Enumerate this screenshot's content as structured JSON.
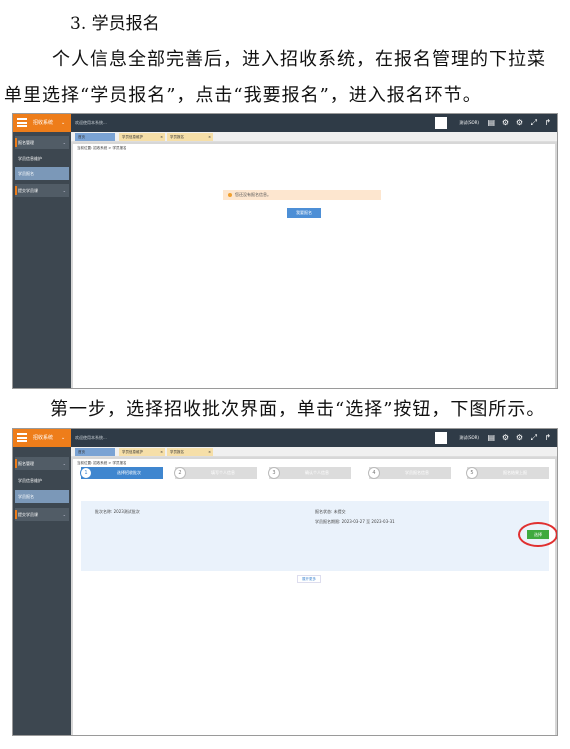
{
  "doc": {
    "heading": "3. 学员报名",
    "line1": "个人信息全部完善后，进入招收系统，在报名管理的下拉菜",
    "line2": "单里选择“学员报名”，点击“我要报名”，进入报名环节。",
    "step1": "第一步，选择招收批次界面，单击“选择”按钮，下图所示。"
  },
  "app": {
    "system_name": "招收系统",
    "notice": "欢迎使用本系统...",
    "user_name": "测试(SOR)",
    "sidebar_items": [
      "报名管理",
      "学员信息维护",
      "学员报名",
      "提交学员课"
    ],
    "tabs": [
      "首页",
      "学员信息维护",
      "学员报名"
    ],
    "breadcrumb": "当前位置: 招收系统 > 学员报名"
  },
  "screen1": {
    "alert_text": "您还没有报名信息。",
    "signup_button": "我要报名"
  },
  "screen2": {
    "steps": [
      {
        "num": "1",
        "label": "选择招收批次"
      },
      {
        "num": "2",
        "label": "填写个人信息"
      },
      {
        "num": "3",
        "label": "确认个人信息"
      },
      {
        "num": "4",
        "label": "学员报名信息"
      },
      {
        "num": "5",
        "label": "报名结果上报"
      }
    ],
    "batch_label": "批次名称: 2023测试批次",
    "status": "报名状态: 未提交",
    "period": "学员报名期限: 2023-03-27 至 2023-03-31",
    "select_button": "选择",
    "more_link": "展开更多"
  },
  "colors": {
    "topbar": "#2f3b47",
    "brand_orange": "#ee7d1a",
    "primary_blue": "#3f86cf",
    "select_green": "#3faa3f",
    "highlight_red": "#e03030"
  }
}
